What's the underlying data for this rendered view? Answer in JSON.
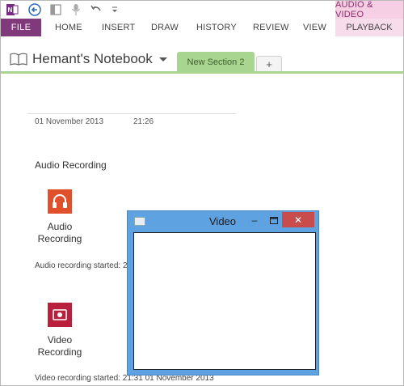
{
  "ribbon": {
    "contextual_group": "AUDIO & VIDEO",
    "contextual_tab": "PLAYBACK",
    "file_tab": "FILE",
    "tabs": [
      "HOME",
      "INSERT",
      "DRAW",
      "HISTORY",
      "REVIEW",
      "VIEW"
    ]
  },
  "quick_access": {
    "icons": [
      "onenote-logo-icon",
      "back-icon",
      "dock-icon",
      "microphone-icon",
      "undo-icon",
      "customize-icon"
    ]
  },
  "notebook": {
    "title": "Hemant's Notebook",
    "section_tab": "New Section 2",
    "add_tab_label": "+",
    "accent_color": "#a8d690"
  },
  "page": {
    "date": "01 November 2013",
    "time": "21:26",
    "heading": "Audio Recording",
    "audio": {
      "label_line1": "Audio",
      "label_line2": "Recording",
      "icon_color": "#e0512b",
      "note": "Audio recording started: 2"
    },
    "video": {
      "label_line1": "Video",
      "label_line2": "Recording",
      "icon_color": "#b8203e",
      "note": "Video recording started: 21:31 01 November 2013"
    }
  },
  "video_window": {
    "title": "Video",
    "minimize_glyph": "–",
    "close_glyph": "✕"
  }
}
